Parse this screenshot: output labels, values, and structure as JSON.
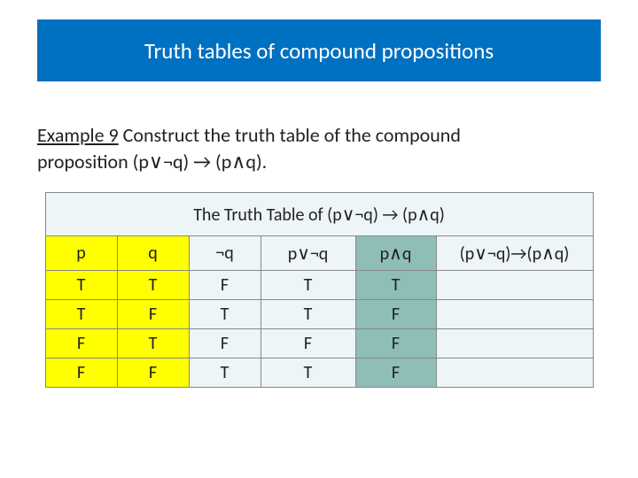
{
  "title": "Truth tables of compound propositions",
  "example_label": "Example 9",
  "example_text_1": " Construct the truth table of the compound",
  "example_text_2": "proposition (p∨¬q) → (p∧q).",
  "table_title": "The Truth Table of (p∨¬q) → (p∧q)",
  "headers": {
    "p": "p",
    "q": "q",
    "nq": "¬q",
    "pvnq": "p∨¬q",
    "paq": "p∧q",
    "imp": "(p∨¬q)→(p∧q)"
  },
  "rows": [
    {
      "p": "T",
      "q": "T",
      "nq": "F",
      "pvnq": "T",
      "paq": "T",
      "imp": ""
    },
    {
      "p": "T",
      "q": "F",
      "nq": "T",
      "pvnq": "T",
      "paq": "F",
      "imp": ""
    },
    {
      "p": "F",
      "q": "T",
      "nq": "F",
      "pvnq": "F",
      "paq": "F",
      "imp": ""
    },
    {
      "p": "F",
      "q": "F",
      "nq": "T",
      "pvnq": "T",
      "paq": "F",
      "imp": ""
    }
  ],
  "chart_data": {
    "type": "table",
    "title": "The Truth Table of (p∨¬q) → (p∧q)",
    "columns": [
      "p",
      "q",
      "¬q",
      "p∨¬q",
      "p∧q",
      "(p∨¬q)→(p∧q)"
    ],
    "data": [
      [
        "T",
        "T",
        "F",
        "T",
        "T",
        ""
      ],
      [
        "T",
        "F",
        "T",
        "T",
        "F",
        ""
      ],
      [
        "F",
        "T",
        "F",
        "F",
        "F",
        ""
      ],
      [
        "F",
        "F",
        "T",
        "T",
        "F",
        ""
      ]
    ]
  }
}
